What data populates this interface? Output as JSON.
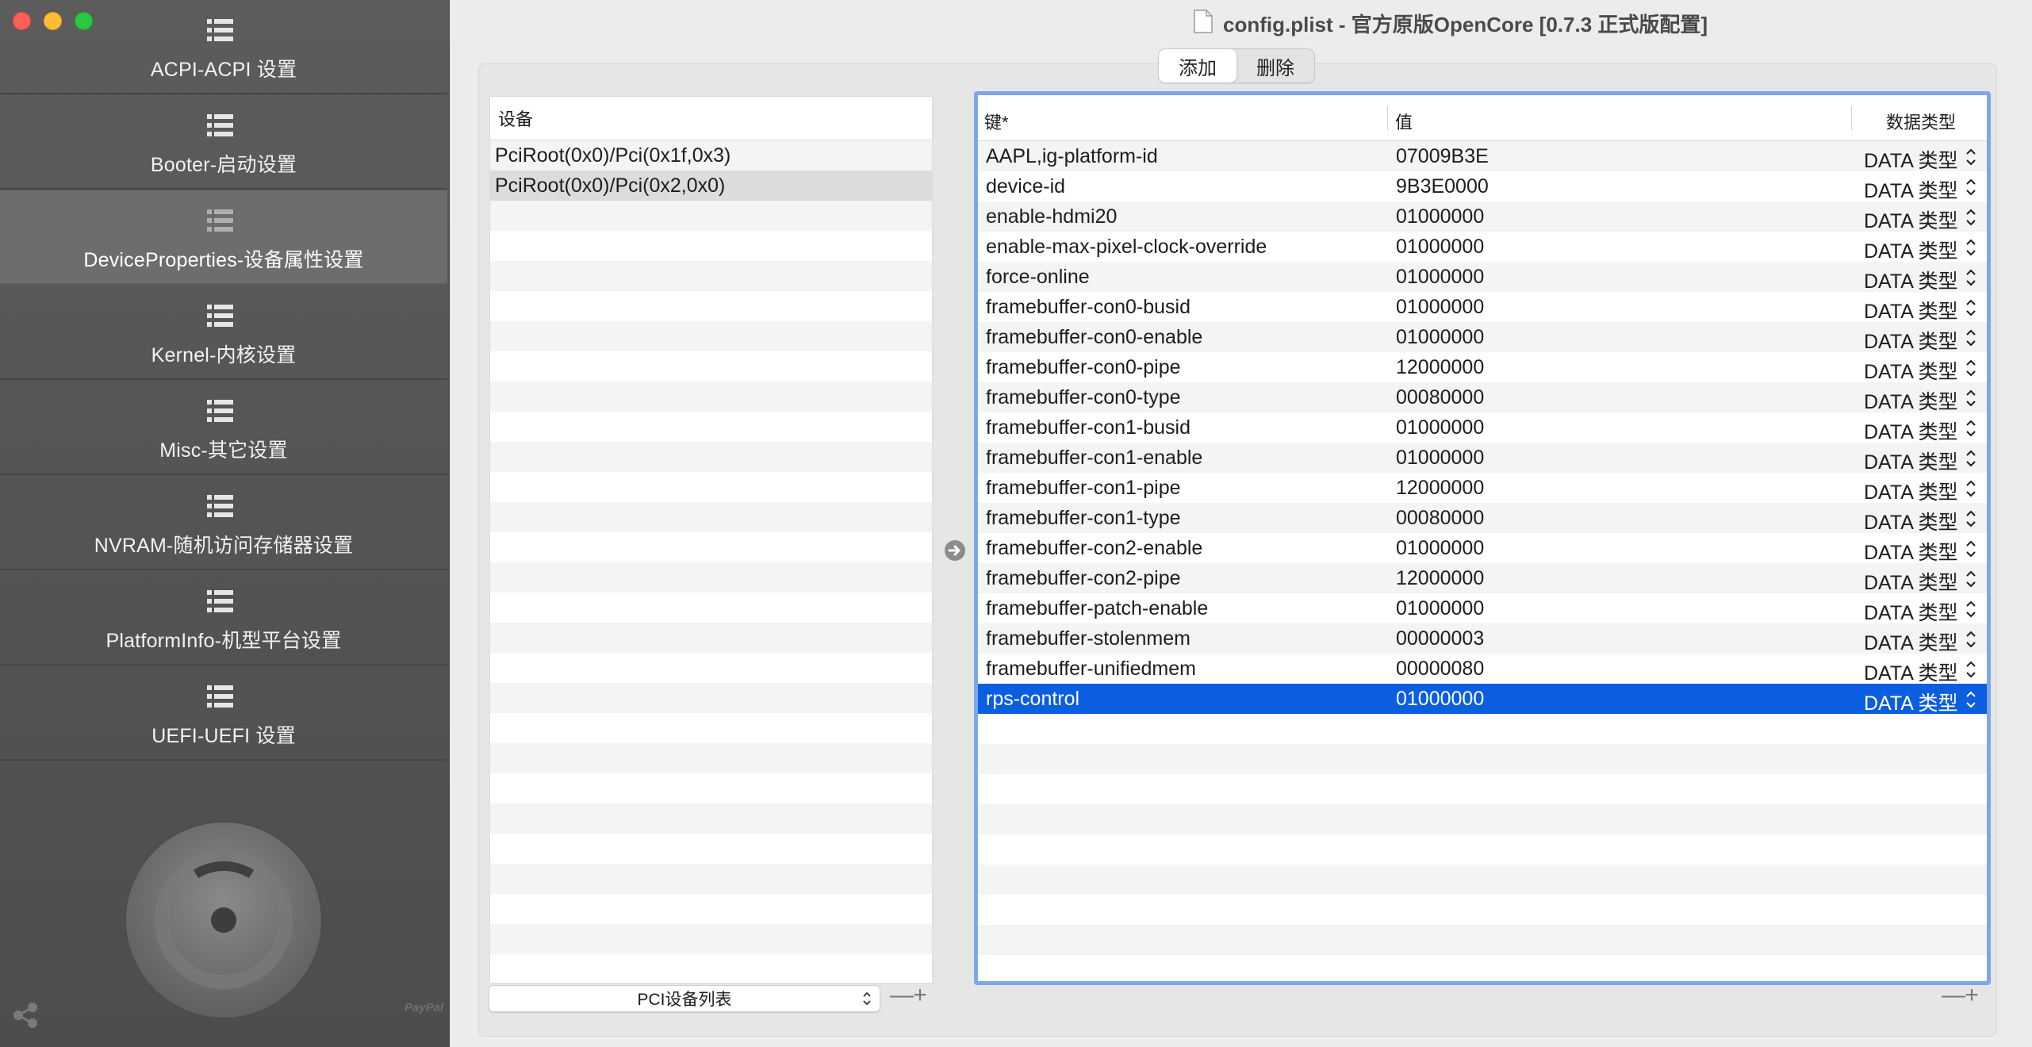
{
  "window": {
    "title": "config.plist - 官方原版OpenCore [0.7.3 正式版配置]"
  },
  "sidebar": {
    "items": [
      {
        "label": "ACPI-ACPI 设置"
      },
      {
        "label": "Booter-启动设置"
      },
      {
        "label": "DeviceProperties-设备属性设置"
      },
      {
        "label": "Kernel-内核设置"
      },
      {
        "label": "Misc-其它设置"
      },
      {
        "label": "NVRAM-随机访问存储器设置"
      },
      {
        "label": "PlatformInfo-机型平台设置"
      },
      {
        "label": "UEFI-UEFI 设置"
      }
    ],
    "active_index": 2,
    "paypal_label": "PayPal"
  },
  "toolbar": {
    "add_label": "添加",
    "delete_label": "删除"
  },
  "devices": {
    "header": "设备",
    "rows": [
      "PciRoot(0x0)/Pci(0x1f,0x3)",
      "PciRoot(0x0)/Pci(0x2,0x0)"
    ],
    "selected_index": 1,
    "popup_label": "PCI设备列表"
  },
  "properties": {
    "headers": {
      "key": "键*",
      "value": "值",
      "type": "数据类型"
    },
    "rows": [
      {
        "key": "AAPL,ig-platform-id",
        "value": "07009B3E",
        "type": "DATA 类型"
      },
      {
        "key": "device-id",
        "value": "9B3E0000",
        "type": "DATA 类型"
      },
      {
        "key": "enable-hdmi20",
        "value": "01000000",
        "type": "DATA 类型"
      },
      {
        "key": "enable-max-pixel-clock-override",
        "value": "01000000",
        "type": "DATA 类型"
      },
      {
        "key": "force-online",
        "value": "01000000",
        "type": "DATA 类型"
      },
      {
        "key": "framebuffer-con0-busid",
        "value": "01000000",
        "type": "DATA 类型"
      },
      {
        "key": "framebuffer-con0-enable",
        "value": "01000000",
        "type": "DATA 类型"
      },
      {
        "key": "framebuffer-con0-pipe",
        "value": "12000000",
        "type": "DATA 类型"
      },
      {
        "key": "framebuffer-con0-type",
        "value": "00080000",
        "type": "DATA 类型"
      },
      {
        "key": "framebuffer-con1-busid",
        "value": "01000000",
        "type": "DATA 类型"
      },
      {
        "key": "framebuffer-con1-enable",
        "value": "01000000",
        "type": "DATA 类型"
      },
      {
        "key": "framebuffer-con1-pipe",
        "value": "12000000",
        "type": "DATA 类型"
      },
      {
        "key": "framebuffer-con1-type",
        "value": "00080000",
        "type": "DATA 类型"
      },
      {
        "key": "framebuffer-con2-enable",
        "value": "01000000",
        "type": "DATA 类型"
      },
      {
        "key": "framebuffer-con2-pipe",
        "value": "12000000",
        "type": "DATA 类型"
      },
      {
        "key": "framebuffer-patch-enable",
        "value": "01000000",
        "type": "DATA 类型"
      },
      {
        "key": "framebuffer-stolenmem",
        "value": "00000003",
        "type": "DATA 类型"
      },
      {
        "key": "framebuffer-unifiedmem",
        "value": "00000080",
        "type": "DATA 类型"
      },
      {
        "key": "rps-control",
        "value": "01000000",
        "type": "DATA 类型"
      }
    ],
    "selected_index": 18
  },
  "controls": {
    "minus": "—",
    "plus": "+"
  }
}
